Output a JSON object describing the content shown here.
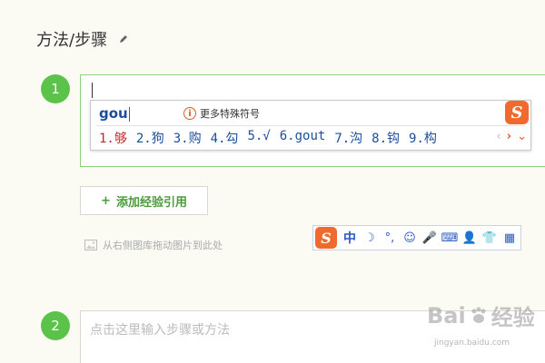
{
  "section": {
    "title": "方法/步骤"
  },
  "step1": {
    "number": "1"
  },
  "ime": {
    "pinyin": "gou",
    "special_symbols": "更多特殊符号",
    "candidates": [
      "1.够",
      "2.狗",
      "3.购",
      "4.勾",
      "5.√",
      "6.gout",
      "7.沟",
      "8.钩",
      "9.构"
    ],
    "prev": "‹",
    "next": "›",
    "more": "⌄",
    "logo": "S"
  },
  "add_reference": {
    "label": "添加经验引用",
    "plus": "+"
  },
  "drag_hint": "从右侧图库拖动图片到此处",
  "toolbar": {
    "logo": "S",
    "lang": "中",
    "moon": "☽",
    "punct": "°,",
    "emoji": "☺",
    "mic": "🎤",
    "keyboard": "⌨",
    "user": "👤",
    "skin": "👕",
    "grid": "▦"
  },
  "step2": {
    "number": "2",
    "placeholder": "点击这里输入步骤或方法"
  },
  "watermark": {
    "text_left": "Bai",
    "text_right": "经验",
    "url": "jingyan.baidu.com"
  },
  "colors": {
    "accent_green": "#5cc34a",
    "sogou_orange": "#f06a2e",
    "candidate_blue": "#1a4e9c"
  }
}
